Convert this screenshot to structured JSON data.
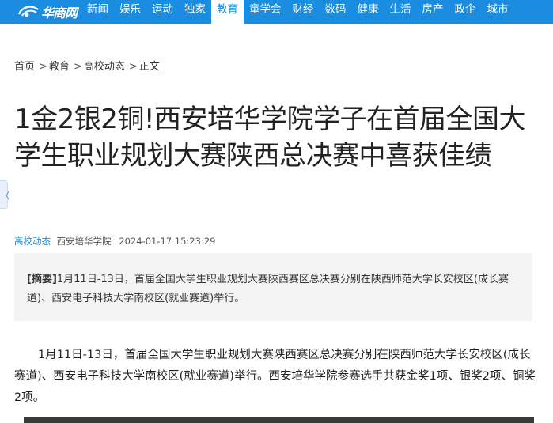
{
  "nav": {
    "logo_text": "华商网",
    "items": [
      {
        "label": "新闻",
        "active": false
      },
      {
        "label": "娱乐",
        "active": false
      },
      {
        "label": "运动",
        "active": false
      },
      {
        "label": "独家",
        "active": false
      },
      {
        "label": "教育",
        "active": true
      },
      {
        "label": "童学会",
        "active": false
      },
      {
        "label": "财经",
        "active": false
      },
      {
        "label": "数码",
        "active": false
      },
      {
        "label": "健康",
        "active": false
      },
      {
        "label": "生活",
        "active": false
      },
      {
        "label": "房产",
        "active": false
      },
      {
        "label": "政企",
        "active": false
      },
      {
        "label": "城市",
        "active": false
      }
    ],
    "accent": "#1a8de0"
  },
  "breadcrumb": {
    "items": [
      "首页",
      "教育",
      "高校动态",
      "正文"
    ],
    "separator": ">"
  },
  "article": {
    "title": "1金2银2铜!西安培华学院学子在首届全国大学生职业规划大赛陕西总决赛中喜获佳绩",
    "category": "高校动态",
    "source": "西安培华学院",
    "time": "2024-01-17 15:23:29",
    "summary_tag": "[摘要]",
    "summary_text": "1月11日-13日，首届全国大学生职业规划大赛陕西赛区总决赛分别在陕西师范大学长安校区(成长赛道)、西安电子科技大学南校区(就业赛道)举行。",
    "paragraph": "1月11日-13日，首届全国大学生职业规划大赛陕西赛区总决赛分别在陕西师范大学长安校区(成长赛道)、西安电子科技大学南校区(就业赛道)举行。西安培华学院参赛选手共获金奖1项、银奖2项、铜奖2项。"
  },
  "icons": {
    "logo": "huashang-logo-icon",
    "side_tab": "side-tab-icon"
  }
}
